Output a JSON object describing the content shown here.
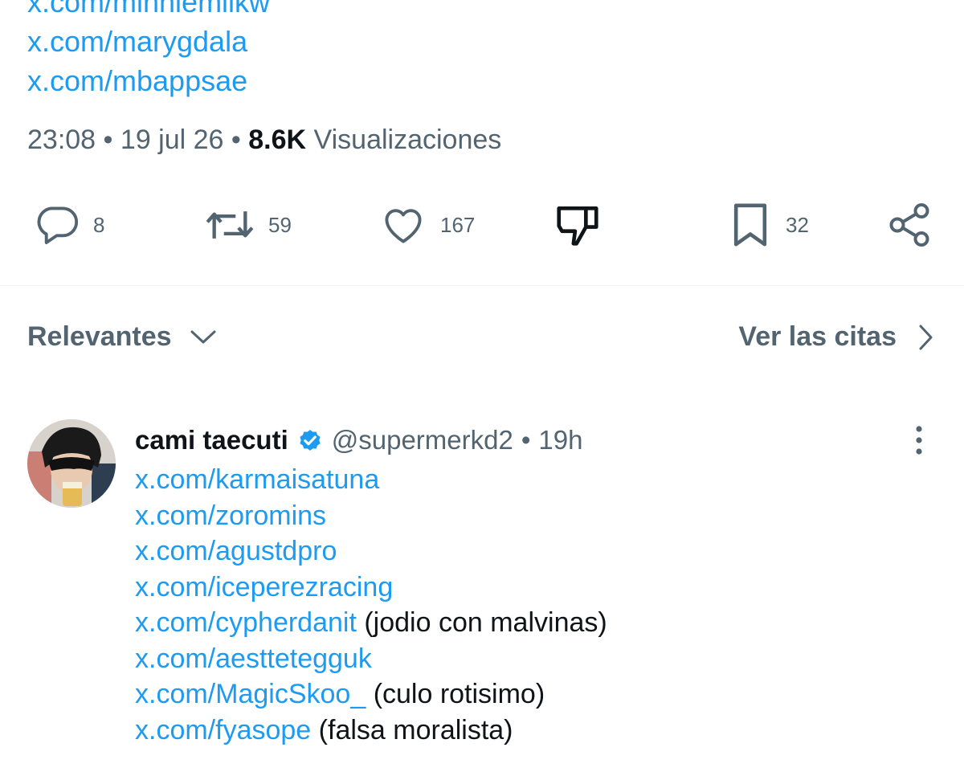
{
  "tweet": {
    "top_links": [
      "x.com/minniemilkw",
      "x.com/marygdala",
      "x.com/mbappsae"
    ],
    "time": "23:08",
    "separator": "•",
    "date": "19 jul 26",
    "views_count": "8.6K",
    "views_label": "Visualizaciones",
    "actions": {
      "replies": "8",
      "reposts": "59",
      "likes": "167",
      "bookmarks": "32"
    }
  },
  "sort": {
    "label": "Relevantes",
    "quotes_label": "Ver las citas"
  },
  "reply": {
    "name": "cami taecuti",
    "handle": "@supermerkd2",
    "separator": "•",
    "time": "19h",
    "lines": [
      {
        "link": "x.com/karmaisatuna",
        "note": ""
      },
      {
        "link": "x.com/zoromins",
        "note": ""
      },
      {
        "link": "x.com/agustdpro",
        "note": ""
      },
      {
        "link": "x.com/iceperezracing",
        "note": ""
      },
      {
        "link": "x.com/cypherdanit",
        "note": "(jodio con malvinas)"
      },
      {
        "link": "x.com/aesttetegguk",
        "note": ""
      },
      {
        "link": "x.com/MagicSkoo_",
        "note": "(culo rotisimo)"
      },
      {
        "link": "x.com/fyasope",
        "note": "(falsa moralista)"
      }
    ]
  },
  "colors": {
    "link": "#1d9bf0",
    "muted": "#536471",
    "text": "#0f1419",
    "verified": "#1d9bf0"
  }
}
